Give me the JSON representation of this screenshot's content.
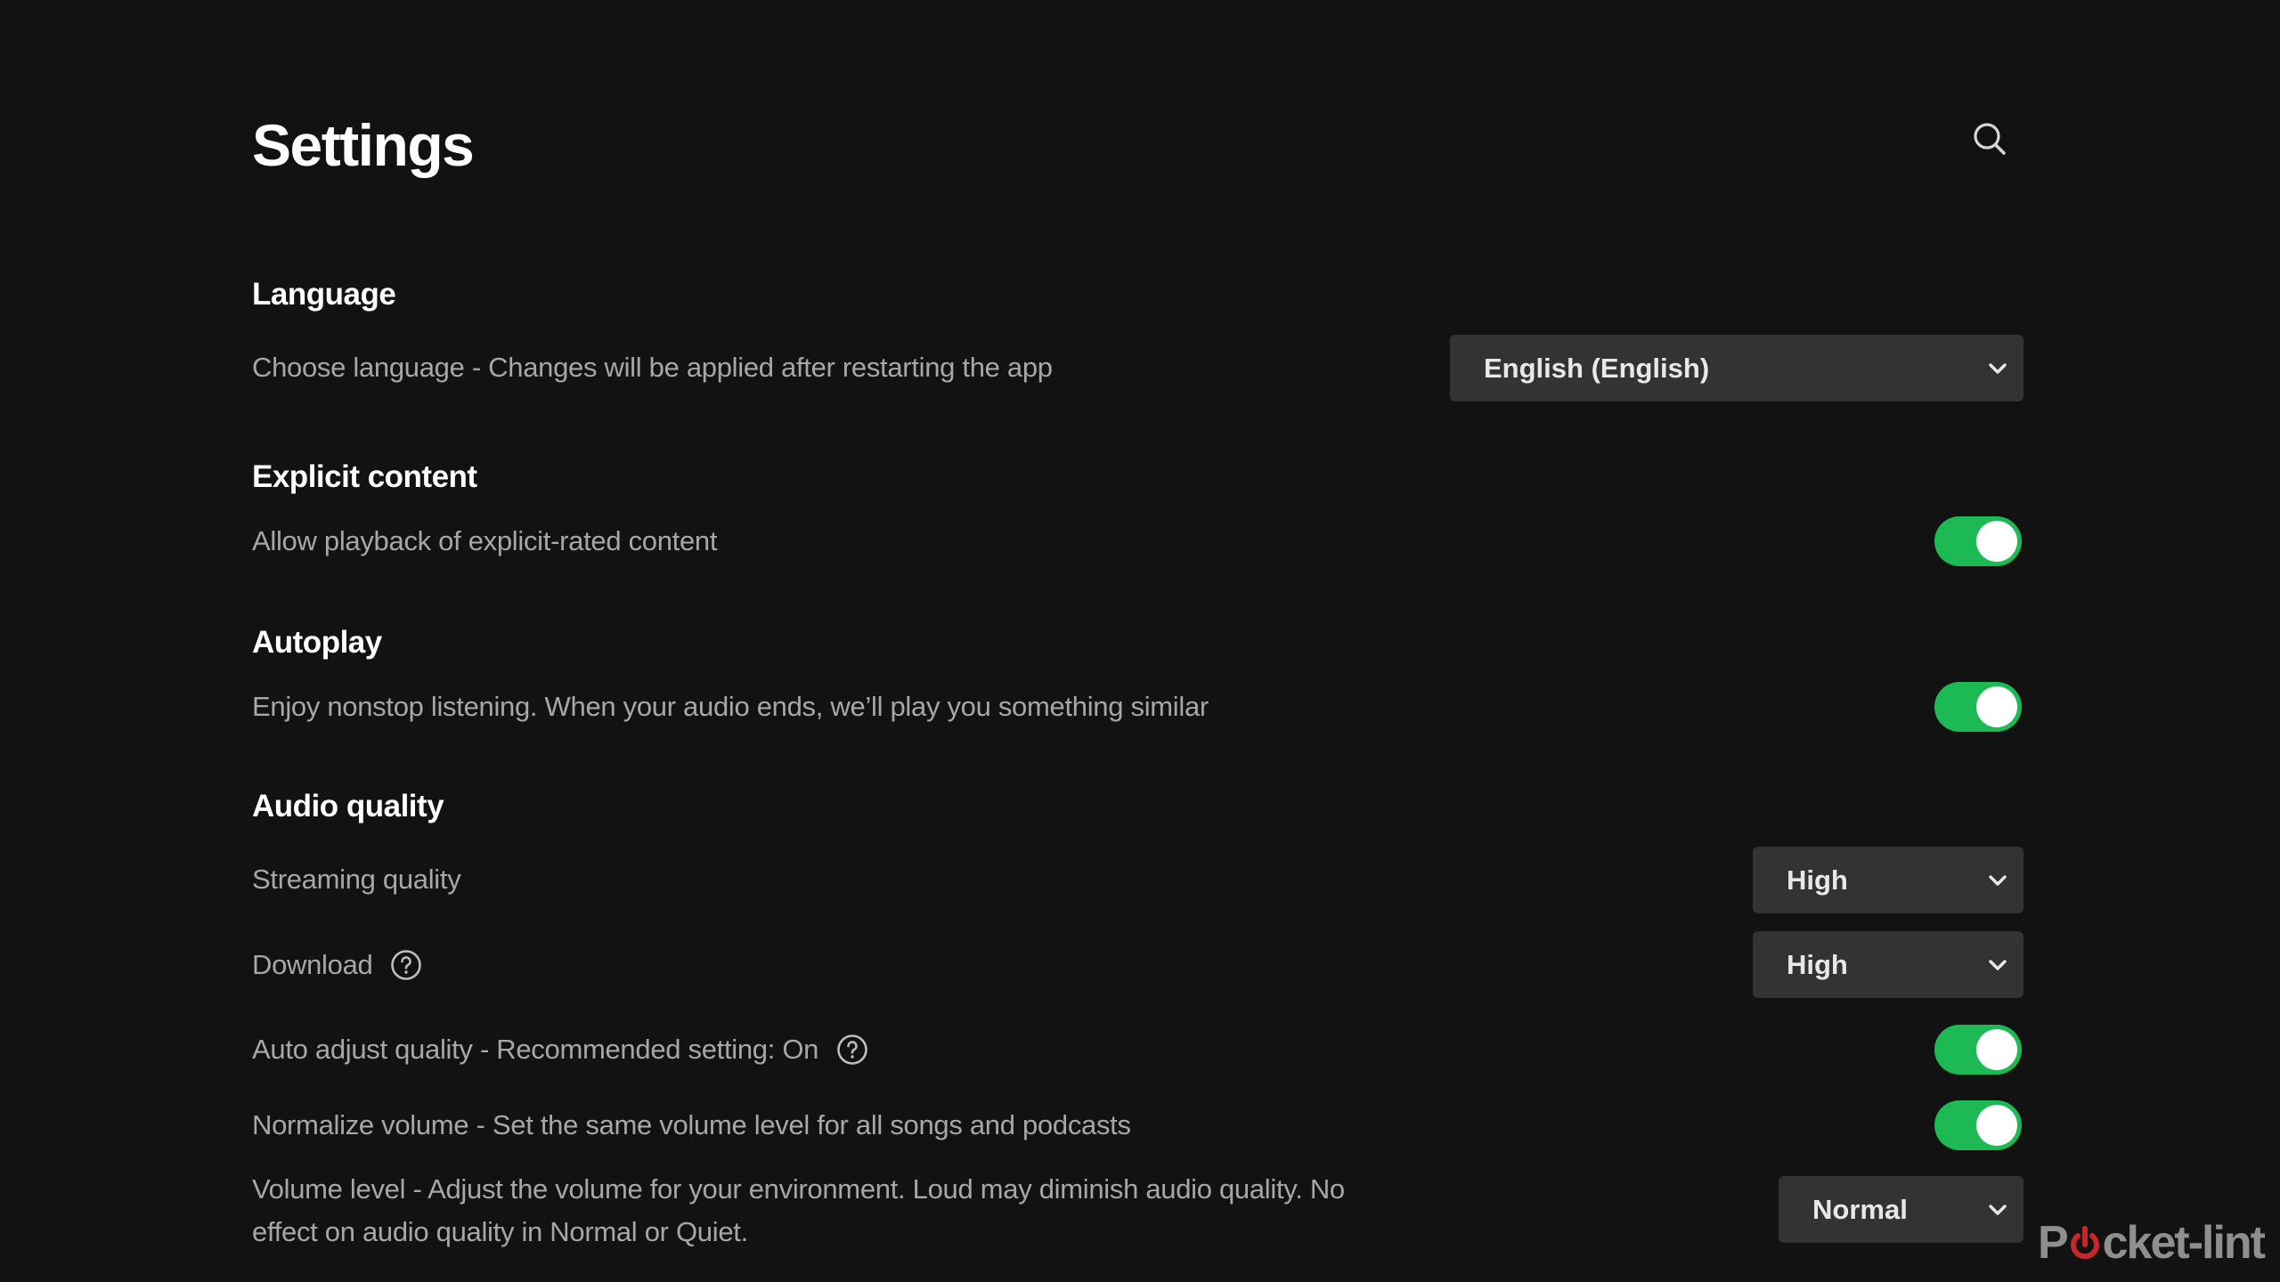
{
  "page": {
    "title": "Settings",
    "search_icon": "search-icon"
  },
  "colors": {
    "background": "#121212",
    "accent_green": "#1db954",
    "dropdown_bg": "#333333",
    "heading_text": "#ffffff",
    "secondary_text": "#a7a7a7"
  },
  "sections": {
    "language": {
      "heading": "Language",
      "choose_label": "Choose language - Changes will be applied after restarting the app",
      "choose_value": "English (English)"
    },
    "explicit": {
      "heading": "Explicit content",
      "allow_label": "Allow playback of explicit-rated content",
      "allow_on": true
    },
    "autoplay": {
      "heading": "Autoplay",
      "enjoy_label": "Enjoy nonstop listening. When your audio ends, we’ll play you something similar",
      "enjoy_on": true
    },
    "audio": {
      "heading": "Audio quality",
      "streaming_label": "Streaming quality",
      "streaming_value": "High",
      "download_label": "Download",
      "download_value": "High",
      "auto_adjust_label": "Auto adjust quality - Recommended setting: On",
      "auto_adjust_on": true,
      "normalize_label": "Normalize volume - Set the same volume level for all songs and podcasts",
      "normalize_on": true,
      "volume_label": "Volume level - Adjust the volume for your environment. Loud may diminish audio quality. No effect on audio quality in Normal or Quiet.",
      "volume_value": "Normal"
    }
  },
  "watermark": {
    "prefix": "P",
    "suffix": "cket-lint"
  }
}
